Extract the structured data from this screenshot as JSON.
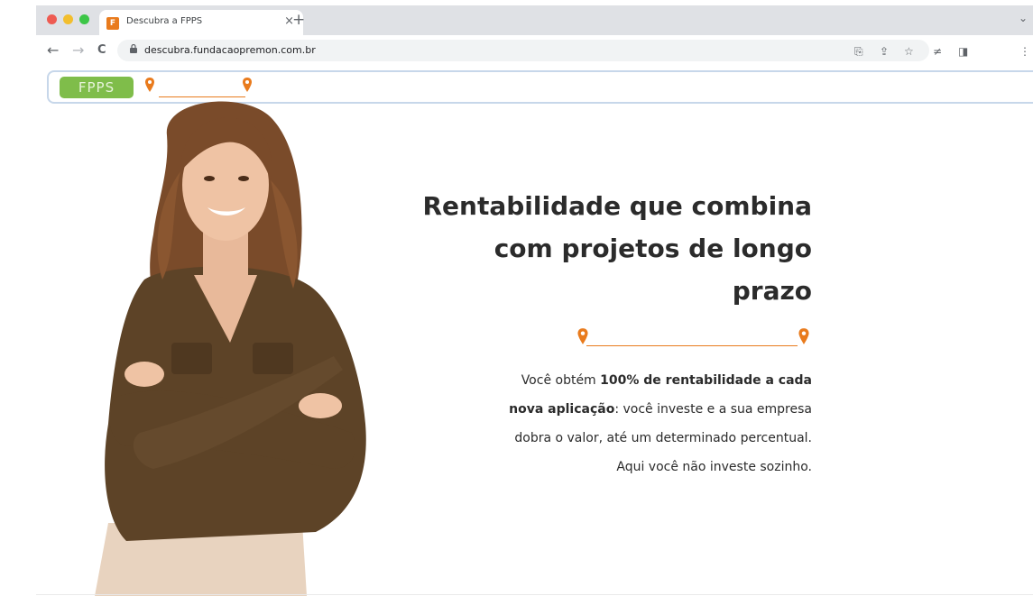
{
  "browser": {
    "tab_title": "Descubra a FPPS",
    "tab_close": "×",
    "new_tab": "+",
    "tab_caret": "⌄",
    "url": "descubra.fundacaopremon.com.br",
    "nav": {
      "back": "←",
      "forward": "→",
      "reload": "C"
    },
    "extension_icons": [
      "translate-icon",
      "share-icon",
      "bookmark-star-icon",
      "extensions-icon",
      "side-panel-icon"
    ],
    "colors": {
      "red": "#ee5b52",
      "yellow": "#f2be2e",
      "green": "#3cc647"
    }
  },
  "site": {
    "logo_text": "FPPS",
    "accent": "#e97b1d",
    "logo_color": "#7fbd4a"
  },
  "hero": {
    "headline_lines": [
      "Rentabilidade que combina",
      "com projetos de longo",
      "prazo"
    ],
    "desc_line1_pre": "Você obtém ",
    "desc_line1_bold": "100% de rentabilidade a cada",
    "desc_line2_bold": "nova aplicação",
    "desc_line2_rest": ": você investe e a sua empresa",
    "desc_line3": "dobra o valor, até um determinado percentual.",
    "desc_line4": "Aqui você não investe sozinho."
  }
}
